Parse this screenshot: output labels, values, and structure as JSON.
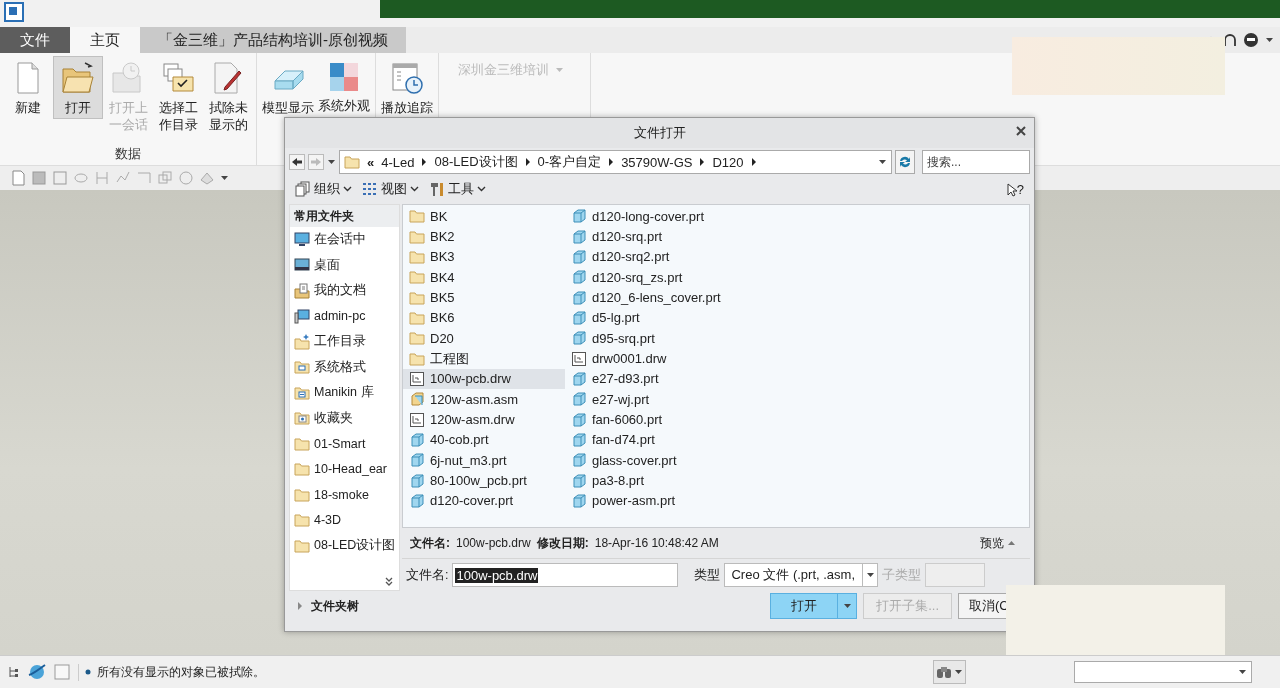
{
  "app": {
    "tabs": [
      {
        "label": "文件",
        "kind": "file",
        "selected": false
      },
      {
        "label": "主页",
        "kind": "normal",
        "selected": true
      },
      {
        "label": "「金三维」产品结构培训-原创视频",
        "kind": "custom",
        "selected": false
      }
    ],
    "ribbon_groups": [
      {
        "label": "数据",
        "buttons": [
          {
            "label": "新建",
            "disabled": false,
            "selected": false
          },
          {
            "label": "打开",
            "disabled": false,
            "selected": true
          },
          {
            "label": "打开上一会话",
            "disabled": true,
            "selected": false
          },
          {
            "label": "选择工作目录",
            "disabled": false,
            "selected": false
          },
          {
            "label": "拭除未显示的",
            "disabled": false,
            "selected": false
          }
        ]
      },
      {
        "buttons": [
          {
            "label": "模型显示",
            "disabled": false,
            "selected": false
          },
          {
            "label": "系统外观",
            "disabled": false,
            "selected": false
          }
        ]
      },
      {
        "buttons": [
          {
            "label": "播放追踪",
            "disabled": false,
            "selected": false
          }
        ]
      },
      {
        "dropdown": {
          "label": "深圳金三维培训",
          "disabled": true
        }
      }
    ]
  },
  "dialog": {
    "title": "文件打开",
    "path_overflow": "«",
    "path": [
      "4-Led",
      "08-LED设计图",
      "0-客户自定",
      "35790W-GS",
      "D120"
    ],
    "search": {
      "placeholder": "搜索..."
    },
    "toolbar": [
      {
        "label": "组织"
      },
      {
        "label": "视图"
      },
      {
        "label": "工具"
      }
    ],
    "help_glyph": "?",
    "sidebar": {
      "heading": "常用文件夹",
      "items": [
        {
          "label": "在会话中"
        },
        {
          "label": "桌面"
        },
        {
          "label": "我的文档"
        },
        {
          "label": "admin-pc"
        },
        {
          "label": "工作目录"
        },
        {
          "label": "系统格式"
        },
        {
          "label": "Manikin 库"
        },
        {
          "label": "收藏夹"
        },
        {
          "label": "01-Smart"
        },
        {
          "label": "10-Head_ear"
        },
        {
          "label": "18-smoke"
        },
        {
          "label": "4-3D"
        },
        {
          "label": "08-LED设计图"
        }
      ],
      "tree_label": "文件夹树"
    },
    "files": [
      {
        "name": "BK",
        "kind": "folder",
        "selected": false
      },
      {
        "name": "BK2",
        "kind": "folder",
        "selected": false
      },
      {
        "name": "BK3",
        "kind": "folder",
        "selected": false
      },
      {
        "name": "BK4",
        "kind": "folder",
        "selected": false
      },
      {
        "name": "BK5",
        "kind": "folder",
        "selected": false
      },
      {
        "name": "BK6",
        "kind": "folder",
        "selected": false
      },
      {
        "name": "D20",
        "kind": "folder",
        "selected": false
      },
      {
        "name": "工程图",
        "kind": "folder",
        "selected": false
      },
      {
        "name": "100w-pcb.drw",
        "kind": "drw",
        "selected": true
      },
      {
        "name": "120w-asm.asm",
        "kind": "asm",
        "selected": false
      },
      {
        "name": "120w-asm.drw",
        "kind": "drw",
        "selected": false
      },
      {
        "name": "40-cob.prt",
        "kind": "prt",
        "selected": false
      },
      {
        "name": "6j-nut_m3.prt",
        "kind": "prt",
        "selected": false
      },
      {
        "name": "80-100w_pcb.prt",
        "kind": "prt",
        "selected": false
      },
      {
        "name": "d120-cover.prt",
        "kind": "prt",
        "selected": false
      },
      {
        "name": "d120-long-cover.prt",
        "kind": "prt",
        "selected": false
      },
      {
        "name": "d120-srq.prt",
        "kind": "prt",
        "selected": false
      },
      {
        "name": "d120-srq2.prt",
        "kind": "prt",
        "selected": false
      },
      {
        "name": "d120-srq_zs.prt",
        "kind": "prt",
        "selected": false
      },
      {
        "name": "d120_6-lens_cover.prt",
        "kind": "prt",
        "selected": false
      },
      {
        "name": "d5-lg.prt",
        "kind": "prt",
        "selected": false
      },
      {
        "name": "d95-srq.prt",
        "kind": "prt",
        "selected": false
      },
      {
        "name": "drw0001.drw",
        "kind": "drw",
        "selected": false
      },
      {
        "name": "e27-d93.prt",
        "kind": "prt",
        "selected": false
      },
      {
        "name": "e27-wj.prt",
        "kind": "prt",
        "selected": false
      },
      {
        "name": "fan-6060.prt",
        "kind": "prt",
        "selected": false
      },
      {
        "name": "fan-d74.prt",
        "kind": "prt",
        "selected": false
      },
      {
        "name": "glass-cover.prt",
        "kind": "prt",
        "selected": false
      },
      {
        "name": "pa3-8.prt",
        "kind": "prt",
        "selected": false
      },
      {
        "name": "power-asm.prt",
        "kind": "prt",
        "selected": false
      }
    ],
    "details": [
      {
        "label": "文件名:",
        "value": "100w-pcb.drw"
      },
      {
        "label": "修改日期:",
        "value": "18-Apr-16 10:48:42 AM"
      }
    ],
    "preview_label": "预览",
    "filename": {
      "label": "文件名:",
      "value": "100w-pcb.drw",
      "text_selected": true
    },
    "type": {
      "label": "类型",
      "value": "Creo 文件 (.prt, .asm,"
    },
    "subtype": {
      "label": "子类型",
      "disabled": true
    },
    "buttons": [
      {
        "label": "打开",
        "kind": "primary",
        "disabled": false
      },
      {
        "label": "打开子集...",
        "kind": "normal",
        "disabled": true
      },
      {
        "label": "取消(C",
        "kind": "normal",
        "disabled": false
      }
    ]
  },
  "status_bar": {
    "message": "所有没有显示的对象已被拭除。"
  }
}
